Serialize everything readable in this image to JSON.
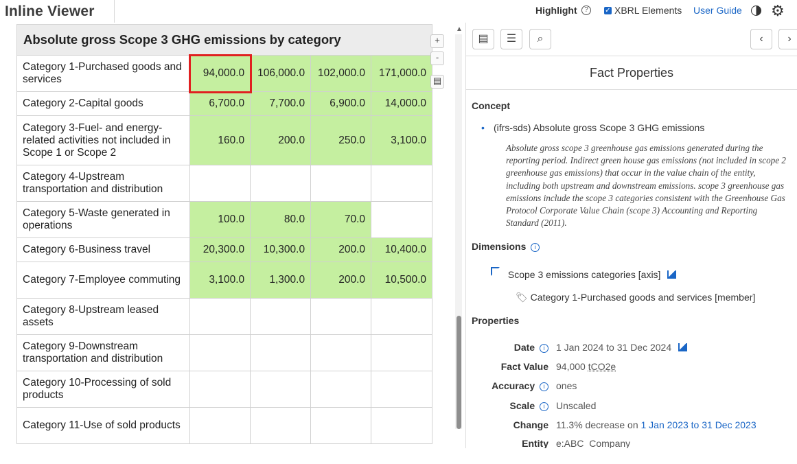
{
  "app": {
    "title": "Inline Viewer",
    "highlight_label": "Highlight",
    "xbrl_label": "XBRL Elements",
    "user_guide_label": "User Guide"
  },
  "table": {
    "title": "Absolute gross Scope 3 GHG emissions by category",
    "zoom_in": "+",
    "zoom_out": "-",
    "rows": [
      {
        "category": "Category 1-Purchased goods and services",
        "values": [
          "94,000.0",
          "106,000.0",
          "102,000.0",
          "171,000.0"
        ]
      },
      {
        "category": "Category 2-Capital goods",
        "values": [
          "6,700.0",
          "7,700.0",
          "6,900.0",
          "14,000.0"
        ]
      },
      {
        "category": "Category 3-Fuel- and energy-related activities not included in Scope 1 or Scope 2",
        "values": [
          "160.0",
          "200.0",
          "250.0",
          "3,100.0"
        ]
      },
      {
        "category": "Category 4-Upstream transportation and distribution",
        "values": [
          "",
          "",
          "",
          ""
        ]
      },
      {
        "category": "Category 5-Waste generated in operations",
        "values": [
          "100.0",
          "80.0",
          "70.0",
          ""
        ]
      },
      {
        "category": "Category 6-Business travel",
        "values": [
          "20,300.0",
          "10,300.0",
          "200.0",
          "10,400.0"
        ]
      },
      {
        "category": "Category 7-Employee commuting",
        "values": [
          "3,100.0",
          "1,300.0",
          "200.0",
          "10,500.0"
        ]
      },
      {
        "category": "Category 8-Upstream leased assets",
        "values": [
          "",
          "",
          "",
          ""
        ]
      },
      {
        "category": "Category 9-Downstream transportation and distribution",
        "values": [
          "",
          "",
          "",
          ""
        ]
      },
      {
        "category": "Category 10-Processing of sold products",
        "values": [
          "",
          "",
          "",
          ""
        ]
      },
      {
        "category": "Category 11-Use of sold products",
        "values": [
          "",
          "",
          "",
          ""
        ]
      }
    ]
  },
  "panel": {
    "header": "Fact Properties",
    "concept_heading": "Concept",
    "concept_name": "(ifrs-sds) Absolute gross Scope 3 GHG emissions",
    "concept_description": "Absolute gross scope 3 greenhouse gas emissions generated during the reporting period. Indirect green house gas emissions (not included in scope 2 greenhouse gas emissions) that occur in the value chain of the entity, including both upstream and downstream emissions. scope 3 greenhouse gas emissions include the scope 3 categories consistent with the Greenhouse Gas Protocol Corporate Value Chain (scope 3) Accounting and Reporting Standard (2011).",
    "dimensions_heading": "Dimensions",
    "dimension_axis": "Scope 3 emissions categories [axis]",
    "dimension_member": "Category 1-Purchased goods and services [member]",
    "properties_heading": "Properties",
    "properties": {
      "date_label": "Date",
      "date_value": "1 Jan 2024 to 31 Dec 2024",
      "fact_value_label": "Fact Value",
      "fact_value": "94,000",
      "fact_unit": "tCO2e",
      "accuracy_label": "Accuracy",
      "accuracy_value": "ones",
      "scale_label": "Scale",
      "scale_value": "Unscaled",
      "change_label": "Change",
      "change_text": "11.3% decrease on",
      "change_period": "1 Jan 2023 to 31 Dec 2023",
      "entity_label": "Entity",
      "entity_value": "e:ABC  Company"
    }
  },
  "colors": {
    "tagged_cell": "#c5efa0",
    "selection": "#e02020",
    "link": "#1a66c6"
  }
}
